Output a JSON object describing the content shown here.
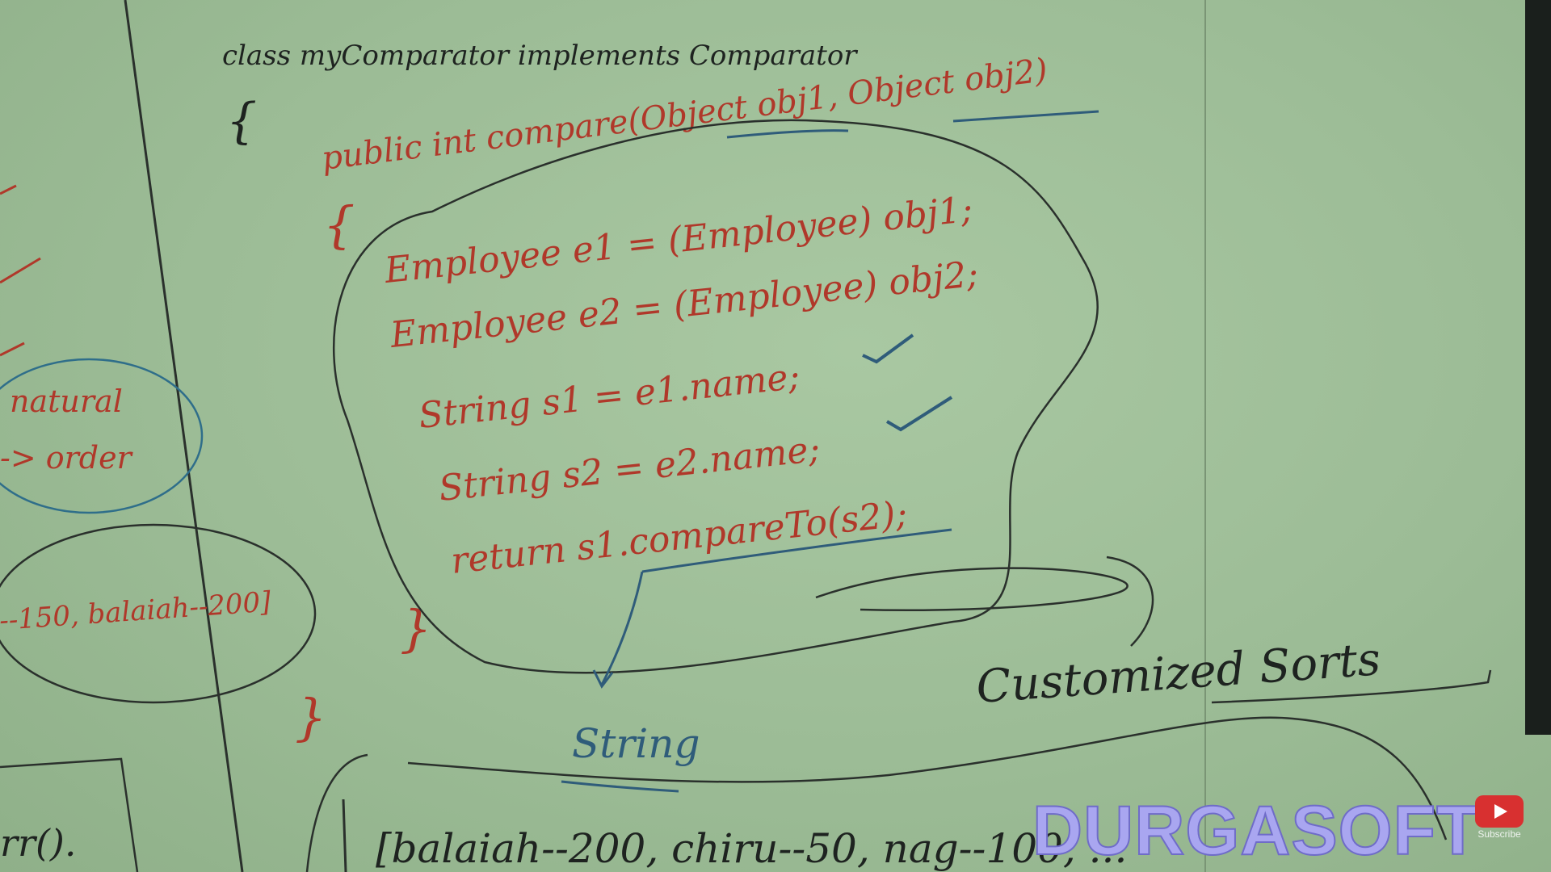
{
  "board": {
    "class_decl": "class myComparator implements Comparator",
    "class_open_brace": "{",
    "method_sig": "public int compare(Object obj1, Object obj2)",
    "method_open_brace": "{",
    "code_lines": [
      "Employee e1 = (Employee) obj1;",
      "Employee e2 = (Employee) obj2;",
      "String s1 = e1.name;",
      "String s2 = e2.name;",
      "return s1.compareTo(s2);"
    ],
    "method_close_brace": "}",
    "class_close_brace": "}",
    "compareTo_annotation": "String",
    "customized_label": "Customized Sorts",
    "left_note_top": [
      "natural",
      "-> order"
    ],
    "left_note_mid": "--150, balaiah--200]",
    "left_note_bottom": "rr().",
    "bottom_line": "[balaiah--200, chiru--50, nag--100, ..."
  },
  "watermark": {
    "text": "DURGASOFT"
  },
  "subscribe": {
    "label": "Subscribe"
  },
  "colors": {
    "board": "#9dbd98",
    "black_ink": "#1e2320",
    "red_ink": "#b0382a",
    "blue_ink": "#2f5c7a"
  }
}
